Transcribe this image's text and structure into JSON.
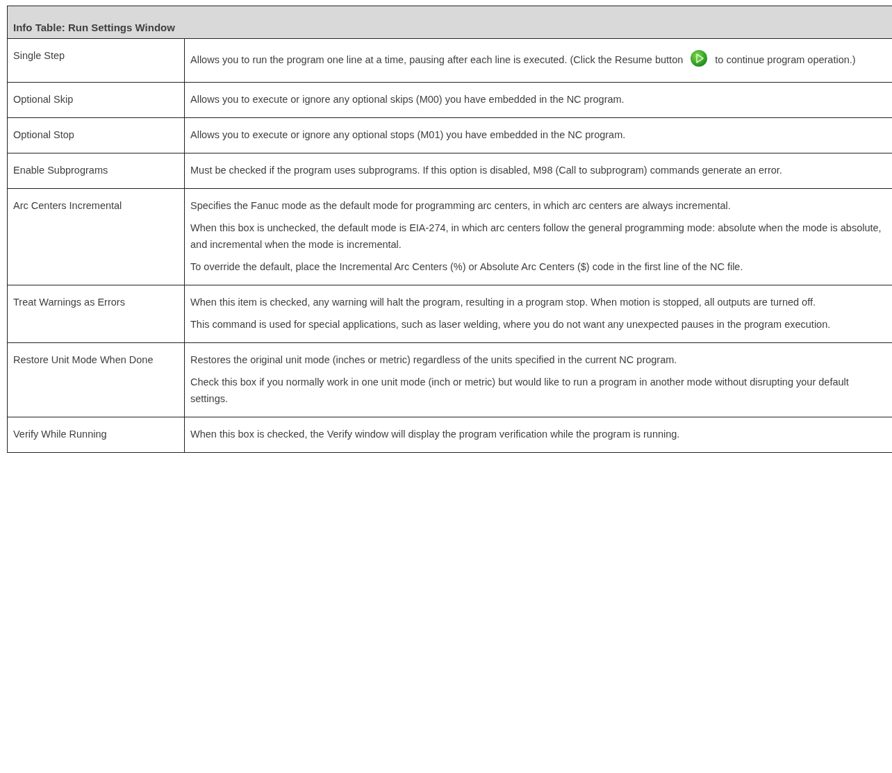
{
  "table": {
    "title": "Info Table: Run Settings Window",
    "rows": [
      {
        "setting": "Single Step",
        "paragraphs": [
          {
            "kind": "icon_text",
            "before": "Allows you to run the program one line at a time, pausing after each line is executed. (Click the Resume button",
            "after": "to continue program operation.)"
          }
        ]
      },
      {
        "setting": "Optional Skip",
        "paragraphs": [
          {
            "kind": "text",
            "text": "Allows you to execute or ignore any optional skips (M00) you have embedded in the NC program."
          }
        ]
      },
      {
        "setting": "Optional Stop",
        "paragraphs": [
          {
            "kind": "text",
            "text": "Allows you to execute or ignore any optional stops (M01) you have embedded in the NC program."
          }
        ]
      },
      {
        "setting": "Enable Subprograms",
        "paragraphs": [
          {
            "kind": "text",
            "text": "Must be checked if the program uses subprograms. If this option is disabled, M98 (Call to subprogram) commands generate an error."
          }
        ]
      },
      {
        "setting": "Arc Centers Incremental",
        "paragraphs": [
          {
            "kind": "text",
            "text": "Specifies the Fanuc mode as the default mode for programming arc centers, in which arc centers are always incremental."
          },
          {
            "kind": "text",
            "text": "When this box is unchecked, the default mode is EIA-274, in which arc centers follow the general programming mode: absolute when the mode is absolute, and incremental when the mode is incremental."
          },
          {
            "kind": "text",
            "text": "To override the default, place the Incremental Arc Centers (%) or Absolute Arc Centers ($) code in the first line of the NC file."
          }
        ]
      },
      {
        "setting": "Treat Warnings as Errors",
        "paragraphs": [
          {
            "kind": "text",
            "text": "When this item is checked, any warning will halt the program, resulting in a program stop. When motion is stopped, all outputs are turned off."
          },
          {
            "kind": "text",
            "text": "This command is used for special applications, such as laser welding, where you do not want any unexpected pauses in the program execution."
          }
        ]
      },
      {
        "setting": "Restore Unit Mode When Done",
        "paragraphs": [
          {
            "kind": "text",
            "text": "Restores the original unit mode (inches or metric) regardless of the units specified in the current NC program."
          },
          {
            "kind": "text",
            "text": "Check this box if you normally work in one unit mode (inch or metric) but would like to run a program in another mode without disrupting your default settings."
          }
        ]
      },
      {
        "setting": "Verify While Running",
        "paragraphs": [
          {
            "kind": "text",
            "text": "When this box is checked, the Verify window will display the program verification while the program is running."
          }
        ]
      }
    ]
  }
}
